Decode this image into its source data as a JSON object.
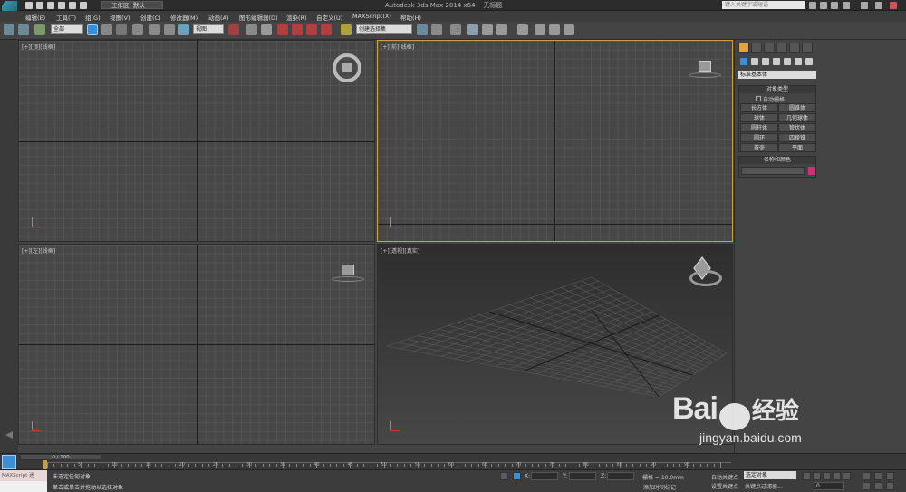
{
  "app": {
    "title": "Autodesk 3ds Max  2014 x64",
    "doc": "无标题",
    "workspace_label": "工作区: 默认",
    "search_placeholder": "键入关键字或短语"
  },
  "menu": [
    "编辑(E)",
    "工具(T)",
    "组(G)",
    "视图(V)",
    "创建(C)",
    "修改器(M)",
    "动画(A)",
    "图形编辑器(D)",
    "渲染(R)",
    "自定义(U)",
    "MAXScript(X)",
    "帮助(H)"
  ],
  "toolbar": {
    "filter": "全部",
    "ref_coord": "视图",
    "selection_set": "创建选择集"
  },
  "viewports": {
    "top": "[+][顶][线框]",
    "front": "[+][前][线框]",
    "left": "[+][左][线框]",
    "persp": "[+][透视][真实]"
  },
  "command_panel": {
    "category": "标准基本体",
    "obj_type_header": "对象类型",
    "autogrid": "自动栅格",
    "objects": [
      "长方体",
      "圆锥体",
      "球体",
      "几何球体",
      "圆柱体",
      "管状体",
      "圆环",
      "四棱锥",
      "茶壶",
      "平面"
    ],
    "name_color_header": "名称和颜色"
  },
  "timeline": {
    "frame": "0 / 100",
    "ticks": [
      "0",
      "5",
      "10",
      "15",
      "20",
      "25",
      "30",
      "35",
      "40",
      "45",
      "50",
      "55",
      "60",
      "65",
      "70",
      "75",
      "80",
      "85",
      "90",
      "95",
      "100"
    ]
  },
  "status": {
    "maxscript": "MAXScript 迷",
    "line1": "未选定任何对象",
    "line2": "单击或单击并拖动以选择对象",
    "x_label": "X:",
    "y_label": "Y:",
    "z_label": "Z:",
    "grid": "栅格 = 10.0mm",
    "autokey": "自动关键点",
    "selected": "选定对象",
    "add_time_tag": "添加时间标记",
    "setkey": "设置关键点",
    "key_filters": "关键点过滤器...",
    "frame_num": "0"
  },
  "watermark": {
    "brand": "Bai",
    "brand2": "经验",
    "url": "jingyan.baidu.com"
  },
  "colors": {
    "accent_orange": "#e8a23c",
    "viewport_active_border": "#c8a040",
    "name_swatch": "#d0307a"
  }
}
